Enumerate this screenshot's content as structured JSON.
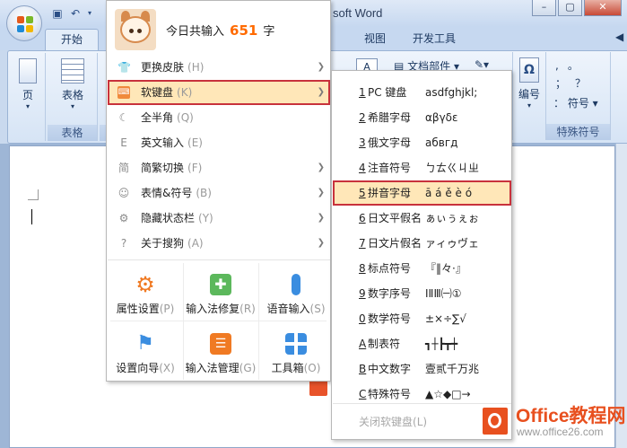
{
  "word": {
    "title": "soft Word",
    "tabs": {
      "home": "开始",
      "view": "视图",
      "developer": "开发工具"
    },
    "ribbon": {
      "page_btn": "页",
      "table_btn": "表格",
      "table_group": "表格",
      "doc_parts": "文档部件",
      "number_btn": "编号",
      "symbol_btn": "符号",
      "special_group": "特殊符号",
      "symbol_glyphs": [
        ",",
        "。",
        "；",
        "？",
        "："
      ]
    }
  },
  "ime": {
    "typed_prefix": "今日共输入",
    "typed_count": "651",
    "typed_suffix": "字",
    "menu": [
      {
        "label": "更换皮肤",
        "key": "(H)",
        "icon": "shirt-icon",
        "arrow": true
      },
      {
        "label": "软键盘",
        "key": "(K)",
        "icon": "keyboard-icon",
        "arrow": true,
        "highlight": true
      },
      {
        "label": "全半角",
        "key": "(Q)",
        "icon": "moon-icon",
        "arrow": false
      },
      {
        "label": "英文输入",
        "key": "(E)",
        "icon": "letter-e-icon",
        "arrow": false
      },
      {
        "label": "简繁切换",
        "key": "(F)",
        "icon": "jian-icon",
        "arrow": true
      },
      {
        "label": "表情&符号",
        "key": "(B)",
        "icon": "smiley-icon",
        "arrow": true
      },
      {
        "label": "隐藏状态栏",
        "key": "(Y)",
        "icon": "hide-statusbar-icon",
        "arrow": true
      },
      {
        "label": "关于搜狗",
        "key": "(A)",
        "icon": "question-icon",
        "arrow": true
      }
    ],
    "tiles": [
      {
        "label": "属性设置",
        "key": "(P)",
        "icon": "gear-icon",
        "color": "#f07a23"
      },
      {
        "label": "输入法修复",
        "key": "(R)",
        "icon": "repair-kit-icon",
        "color": "#5cb85c"
      },
      {
        "label": "语音输入",
        "key": "(S)",
        "icon": "microphone-icon",
        "color": "#3a8de0"
      },
      {
        "label": "设置向导",
        "key": "(X)",
        "icon": "flag-icon",
        "color": "#3a8de0"
      },
      {
        "label": "输入法管理",
        "key": "(G)",
        "icon": "manage-icon",
        "color": "#f07a23"
      },
      {
        "label": "工具箱",
        "key": "(O)",
        "icon": "toolbox-icon",
        "color": "#3a8de0"
      }
    ],
    "softkeyboard": [
      {
        "key": "1",
        "label": "PC 键盘",
        "sample": "asdfghjkl;"
      },
      {
        "key": "2",
        "label": "希腊字母",
        "sample": "αβγδε"
      },
      {
        "key": "3",
        "label": "俄文字母",
        "sample": "абвгд"
      },
      {
        "key": "4",
        "label": "注音符号",
        "sample": "ㄅㄊㄍㄐㄓ"
      },
      {
        "key": "5",
        "label": "拼音字母",
        "sample": "ā á ě è ó",
        "highlight": true
      },
      {
        "key": "6",
        "label": "日文平假名",
        "sample": "ぁぃぅぇぉ"
      },
      {
        "key": "7",
        "label": "日文片假名",
        "sample": "ァィゥヴェ"
      },
      {
        "key": "8",
        "label": "标点符号",
        "sample": "『‖々·』"
      },
      {
        "key": "9",
        "label": "数字序号",
        "sample": "ⅠⅡⅢ㈠①"
      },
      {
        "key": "0",
        "label": "数学符号",
        "sample": "±×÷∑√"
      },
      {
        "key": "A",
        "label": "制表符",
        "sample": "┓┼┣┳┿"
      },
      {
        "key": "B",
        "label": "中文数字",
        "sample": "壹贰千万兆"
      },
      {
        "key": "C",
        "label": "特殊符号",
        "sample": "▲☆◆□→"
      }
    ],
    "close_softkeyboard": "关闭软键盘",
    "close_key": "(L)"
  },
  "watermark": {
    "title": "Office教程网",
    "url": "www.office26.com",
    "color": "#e8501f"
  }
}
